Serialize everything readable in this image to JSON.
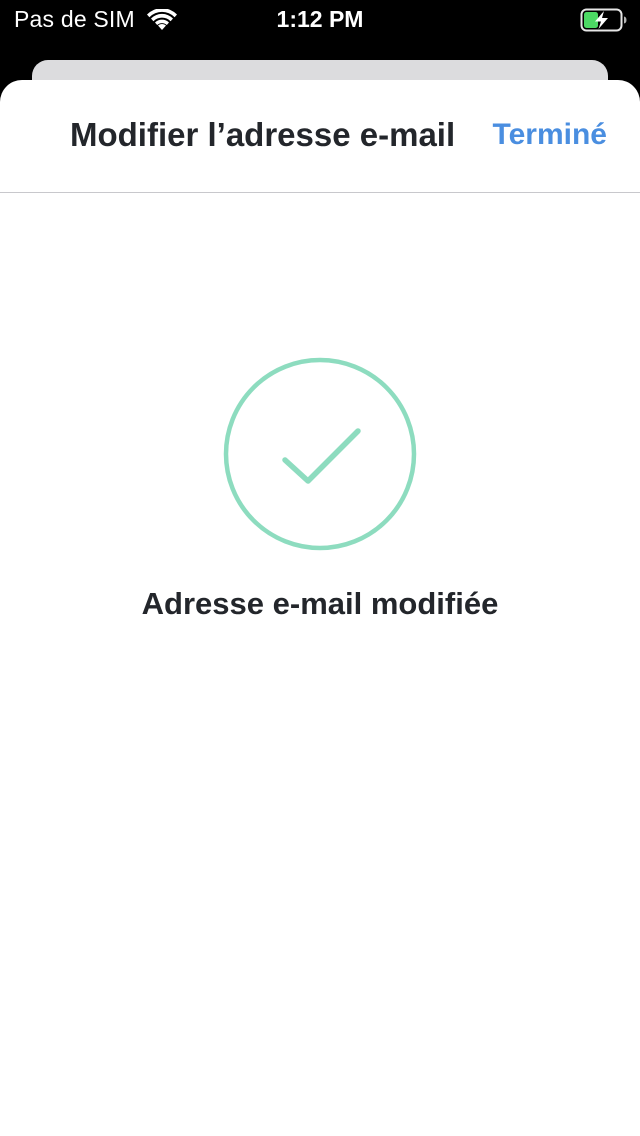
{
  "status_bar": {
    "carrier": "Pas de SIM",
    "time": "1:12 PM",
    "wifi_icon": "wifi-icon",
    "battery_icon": "battery-charging-icon"
  },
  "modal": {
    "title": "Modifier l’adresse e-mail",
    "done_label": "Terminé"
  },
  "success": {
    "icon": "checkmark-circle-icon",
    "message": "Adresse e-mail modifiée"
  },
  "colors": {
    "accent": "#4a8ee0",
    "success": "#8ddcbf",
    "text": "#23262b",
    "battery": "#4cd964"
  }
}
